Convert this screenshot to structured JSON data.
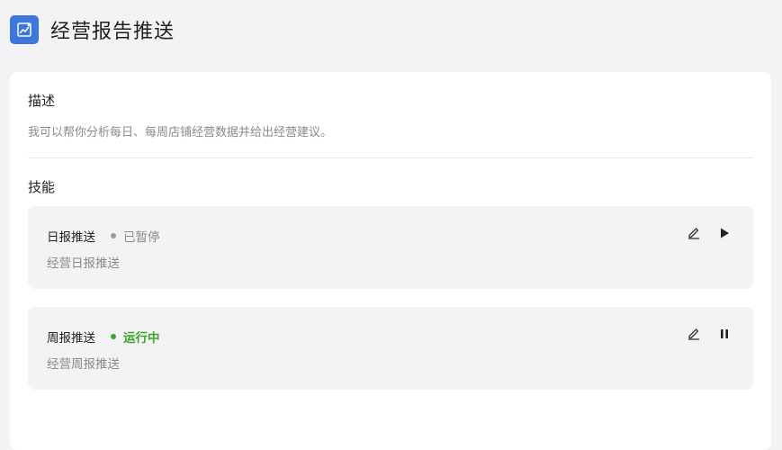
{
  "header": {
    "title": "经营报告推送",
    "icon": "chart-icon",
    "icon_bg": "#3e77dc"
  },
  "description": {
    "heading": "描述",
    "text": "我可以帮你分析每日、每周店铺经营数据并给出经营建议。"
  },
  "skills": {
    "heading": "技能",
    "items": [
      {
        "name": "日报推送",
        "status": "已暂停",
        "status_color": "#8a8a8a",
        "subtitle": "经营日报推送",
        "edit_icon": "edit-icon",
        "toggle_icon": "play-icon"
      },
      {
        "name": "周报推送",
        "status": "运行中",
        "status_color": "#3aa629",
        "subtitle": "经营周报推送",
        "edit_icon": "edit-icon",
        "toggle_icon": "pause-icon"
      }
    ]
  }
}
